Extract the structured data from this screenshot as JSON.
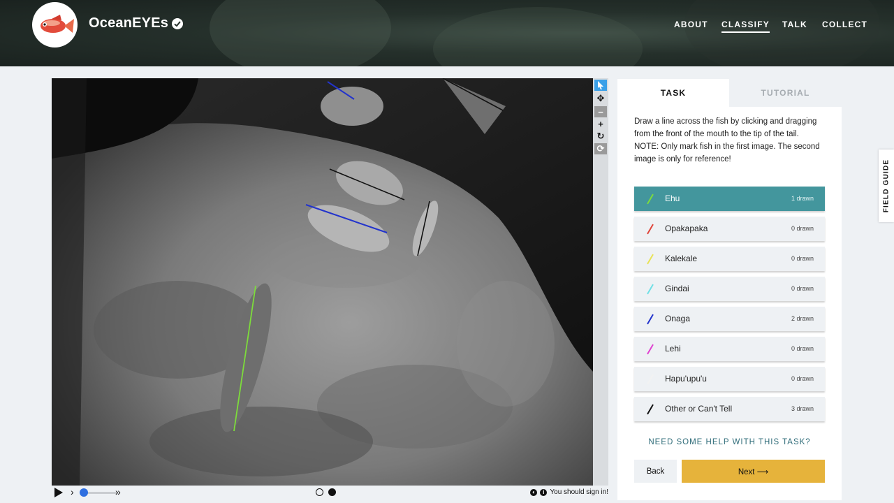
{
  "header": {
    "brand": "OceanEYEs",
    "nav": [
      "ABOUT",
      "CLASSIFY",
      "TALK",
      "COLLECT"
    ],
    "active_nav": "CLASSIFY"
  },
  "tabs": {
    "task": "TASK",
    "tutorial": "TUTORIAL"
  },
  "instructions": {
    "line1": "Draw a line across the fish by clicking and dragging from the front of the mouth to the tip of the tail.",
    "line2": "NOTE: Only mark fish in the first image. The second image is only for reference!"
  },
  "choices": [
    {
      "label": "Ehu",
      "count": "1 drawn",
      "color": "#7ddc3b",
      "selected": true
    },
    {
      "label": "Opakapaka",
      "count": "0 drawn",
      "color": "#e0453a"
    },
    {
      "label": "Kalekale",
      "count": "0 drawn",
      "color": "#e8e356"
    },
    {
      "label": "Gindai",
      "count": "0 drawn",
      "color": "#6fe0e6"
    },
    {
      "label": "Onaga",
      "count": "2 drawn",
      "color": "#2233cc"
    },
    {
      "label": "Lehi",
      "count": "0 drawn",
      "color": "#e040d0"
    },
    {
      "label": "Hapu'upu'u",
      "count": "0 drawn",
      "color": "#f2f2f2"
    },
    {
      "label": "Other or Can't Tell",
      "count": "3 drawn",
      "color": "#111111"
    }
  ],
  "help": "NEED SOME HELP WITH THIS TASK?",
  "buttons": {
    "back": "Back",
    "next": "Next ⟶"
  },
  "field_guide": "FIELD GUIDE",
  "status": {
    "sign_in": "You should sign in!"
  },
  "icons": [
    "pointer-icon",
    "move-icon",
    "zoom-out-icon",
    "zoom-in-icon",
    "rotate-icon",
    "reset-icon",
    "play-icon",
    "invert-icon",
    "info-icon",
    "verified-icon",
    "arrow-right-icon"
  ]
}
